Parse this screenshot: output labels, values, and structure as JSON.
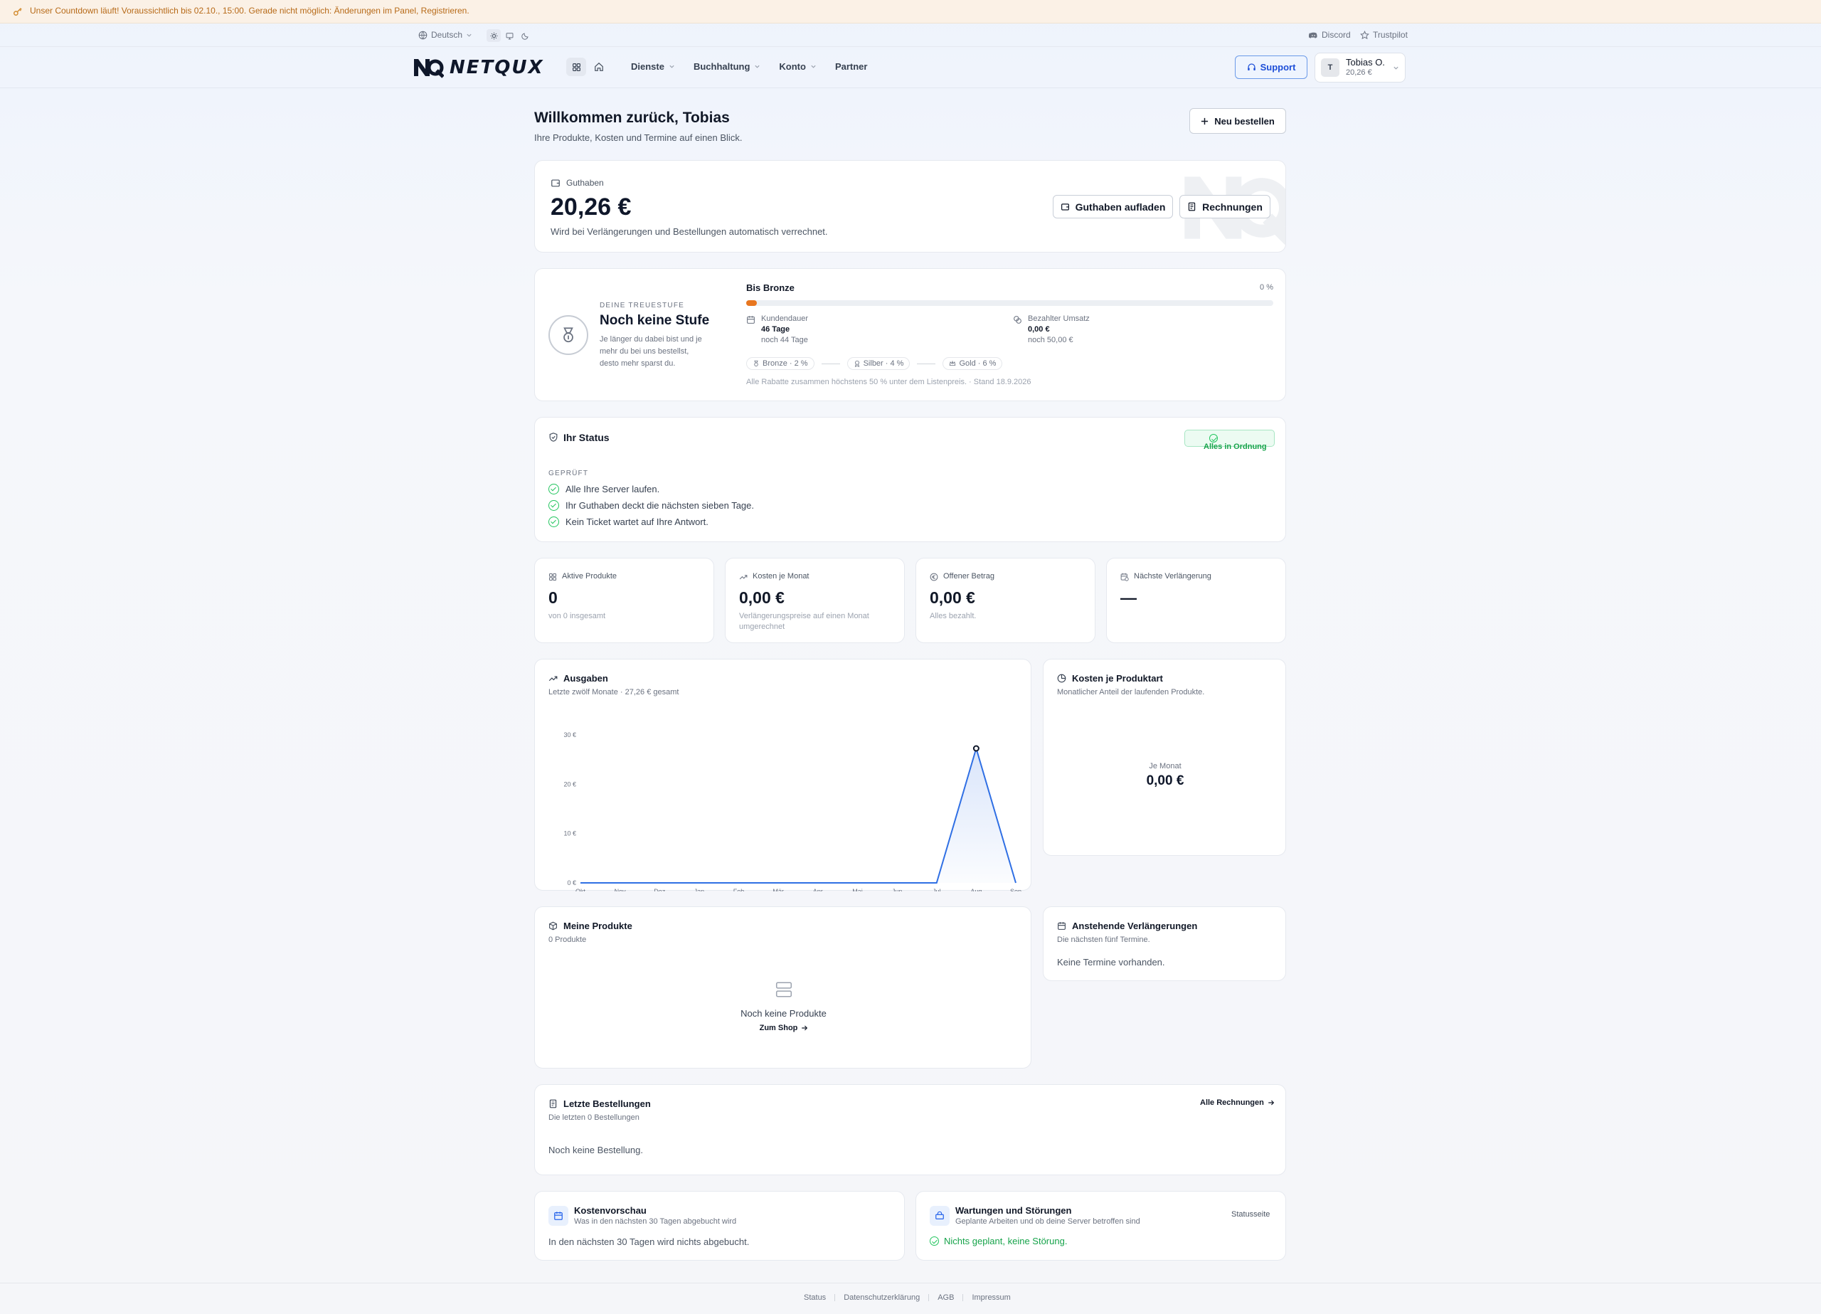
{
  "banner": {
    "text": "Unser Countdown läuft! Voraussichtlich bis 02.10., 15:00. Gerade nicht möglich: Änderungen im Panel, Registrieren."
  },
  "util": {
    "language": "Deutsch",
    "discord": "Discord",
    "trustpilot": "Trustpilot"
  },
  "nav": {
    "brand": "NETQUX",
    "items": [
      "Dienste",
      "Buchhaltung",
      "Konto",
      "Partner"
    ],
    "support": "Support",
    "user_name": "Tobias O.",
    "user_balance": "20,26 €",
    "avatar": "T"
  },
  "header": {
    "title": "Willkommen zurück, Tobias",
    "subtitle": "Ihre Produkte, Kosten und Termine auf einen Blick.",
    "new_order": "Neu bestellen"
  },
  "balance": {
    "label": "Guthaben",
    "amount": "20,26 €",
    "note": "Wird bei Verlängerungen und Bestellungen automatisch verrechnet.",
    "topup": "Guthaben aufladen",
    "invoices": "Rechnungen"
  },
  "loyalty": {
    "eyebrow": "DEINE TREUESTUFE",
    "title": "Noch keine Stufe",
    "text": "Je länger du dabei bist und je mehr du bei uns bestellst, desto mehr sparst du.",
    "target": "Bis Bronze",
    "percent": "0 %",
    "progress": 0.02,
    "tenure_label": "Kundendauer",
    "tenure_value": "46 Tage",
    "tenure_rest": "noch 44 Tage",
    "sales_label": "Bezahlter Umsatz",
    "sales_value": "0,00 €",
    "sales_rest": "noch 50,00 €",
    "tiers": [
      "Bronze · 2 %",
      "Silber · 4 %",
      "Gold · 6 %"
    ],
    "footnote": "Alle Rabatte zusammen höchstens 50 % unter dem Listenpreis. · Stand 18.9.2026"
  },
  "status": {
    "title": "Ihr Status",
    "badge": "Alles in Ordnung",
    "section": "GEPRÜFT",
    "checks": [
      "Alle Ihre Server laufen.",
      "Ihr Guthaben deckt die nächsten sieben Tage.",
      "Kein Ticket wartet auf Ihre Antwort."
    ]
  },
  "stats": [
    {
      "label": "Aktive Produkte",
      "value": "0",
      "sub": "von 0 insgesamt"
    },
    {
      "label": "Kosten je Monat",
      "value": "0,00 €",
      "sub": "Verlängerungspreise auf einen Monat umgerechnet"
    },
    {
      "label": "Offener Betrag",
      "value": "0,00 €",
      "sub": "Alles bezahlt."
    },
    {
      "label": "Nächste Verlängerung",
      "value": "—",
      "sub": ""
    }
  ],
  "chart": {
    "title": "Ausgaben",
    "subtitle": "Letzte zwölf Monate · 27,26 € gesamt"
  },
  "chart_data": {
    "type": "area",
    "categories": [
      "Okt",
      "Nov",
      "Dez",
      "Jan",
      "Feb",
      "Mär",
      "Apr",
      "Mai",
      "Jun",
      "Jul",
      "Aug",
      "Sep"
    ],
    "values": [
      0,
      0,
      0,
      0,
      0,
      0,
      0,
      0,
      0,
      0,
      27.26,
      0
    ],
    "yticks": [
      "0 €",
      "10 €",
      "20 €",
      "30 €"
    ],
    "ylim": [
      0,
      30
    ],
    "grid": false,
    "color": "#2f6fe4"
  },
  "cost_type": {
    "title": "Kosten je Produktart",
    "subtitle": "Monatlicher Anteil der laufenden Produkte.",
    "center_label": "Je Monat",
    "center_value": "0,00 €"
  },
  "products": {
    "title": "Meine Produkte",
    "count": "0 Produkte",
    "empty": "Noch keine Produkte",
    "shop": "Zum Shop"
  },
  "renewals": {
    "title": "Anstehende Verlängerungen",
    "subtitle": "Die nächsten fünf Termine.",
    "empty": "Keine Termine vorhanden."
  },
  "orders": {
    "title": "Letzte Bestellungen",
    "subtitle": "Die letzten 0 Bestellungen",
    "all": "Alle Rechnungen",
    "empty": "Noch keine Bestellung."
  },
  "preview": {
    "title": "Kostenvorschau",
    "subtitle": "Was in den nächsten 30 Tagen abgebucht wird",
    "text": "In den nächsten 30 Tagen wird nichts abgebucht."
  },
  "maint": {
    "title": "Wartungen und Störungen",
    "subtitle": "Geplante Arbeiten und ob deine Server betroffen sind",
    "link": "Statusseite",
    "text": "Nichts geplant, keine Störung."
  },
  "footer": {
    "links": [
      "Status",
      "Datenschutzerklärung",
      "AGB",
      "Impressum"
    ]
  }
}
